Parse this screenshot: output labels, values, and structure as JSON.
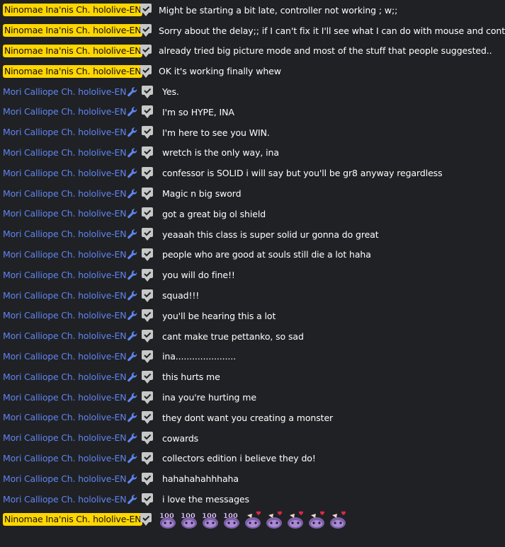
{
  "messages": [
    {
      "author": "Ninomae Ina'nis Ch. hololive-EN",
      "role": "owner",
      "text": "Might be starting a bit late, controller not working ; w;;"
    },
    {
      "author": "Ninomae Ina'nis Ch. hololive-EN",
      "role": "owner",
      "text": "Sorry about the delay;; if I can't fix it I'll see what I can do with mouse and controller"
    },
    {
      "author": "Ninomae Ina'nis Ch. hololive-EN",
      "role": "owner",
      "text": "already tried big picture mode and most of the stuff that people suggested.."
    },
    {
      "author": "Ninomae Ina'nis Ch. hololive-EN",
      "role": "owner",
      "text": "OK it's working finally whew"
    },
    {
      "author": "Mori Calliope Ch. hololive-EN",
      "role": "mod",
      "text": "Yes."
    },
    {
      "author": "Mori Calliope Ch. hololive-EN",
      "role": "mod",
      "text": "I'm so HYPE, INA"
    },
    {
      "author": "Mori Calliope Ch. hololive-EN",
      "role": "mod",
      "text": "I'm here to see you WIN."
    },
    {
      "author": "Mori Calliope Ch. hololive-EN",
      "role": "mod",
      "text": "wretch is the only way, ina"
    },
    {
      "author": "Mori Calliope Ch. hololive-EN",
      "role": "mod",
      "text": "confessor is SOLID i will say but you'll be gr8 anyway regardless"
    },
    {
      "author": "Mori Calliope Ch. hololive-EN",
      "role": "mod",
      "text": "Magic n big sword"
    },
    {
      "author": "Mori Calliope Ch. hololive-EN",
      "role": "mod",
      "text": "got a great big ol shield"
    },
    {
      "author": "Mori Calliope Ch. hololive-EN",
      "role": "mod",
      "text": "yeaaah this class is super solid ur gonna do great"
    },
    {
      "author": "Mori Calliope Ch. hololive-EN",
      "role": "mod",
      "text": "people who are good at souls still die a lot haha"
    },
    {
      "author": "Mori Calliope Ch. hololive-EN",
      "role": "mod",
      "text": "you will do fine!!"
    },
    {
      "author": "Mori Calliope Ch. hololive-EN",
      "role": "mod",
      "text": "squad!!!"
    },
    {
      "author": "Mori Calliope Ch. hololive-EN",
      "role": "mod",
      "text": "you'll be hearing this a lot"
    },
    {
      "author": "Mori Calliope Ch. hololive-EN",
      "role": "mod",
      "text": "cant make true pettanko, so sad"
    },
    {
      "author": "Mori Calliope Ch. hololive-EN",
      "role": "mod",
      "text": "ina......................"
    },
    {
      "author": "Mori Calliope Ch. hololive-EN",
      "role": "mod",
      "text": "this hurts me"
    },
    {
      "author": "Mori Calliope Ch. hololive-EN",
      "role": "mod",
      "text": "ina you're hurting me"
    },
    {
      "author": "Mori Calliope Ch. hololive-EN",
      "role": "mod",
      "text": "they dont want you creating a monster"
    },
    {
      "author": "Mori Calliope Ch. hololive-EN",
      "role": "mod",
      "text": "cowards"
    },
    {
      "author": "Mori Calliope Ch. hololive-EN",
      "role": "mod",
      "text": "collectors edition i believe they do!"
    },
    {
      "author": "Mori Calliope Ch. hololive-EN",
      "role": "mod",
      "text": "hahahahahhhaha"
    },
    {
      "author": "Mori Calliope Ch. hololive-EN",
      "role": "mod",
      "text": "i love the messages"
    }
  ],
  "final_message": {
    "author": "Ninomae Ina'nis Ch. hololive-EN",
    "role": "owner",
    "emotes": [
      "ina-100-emote",
      "ina-100-emote",
      "ina-100-emote",
      "ina-100-emote",
      "ina-heart-emote",
      "ina-heart-emote",
      "ina-heart-emote",
      "ina-heart-emote",
      "ina-heart-emote"
    ]
  },
  "colors": {
    "background": "#202124",
    "owner_badge": "#ffd600",
    "moderator_name": "#5e84f1",
    "message_text": "#ffffff",
    "badge_gray": "#c8c8c8"
  }
}
